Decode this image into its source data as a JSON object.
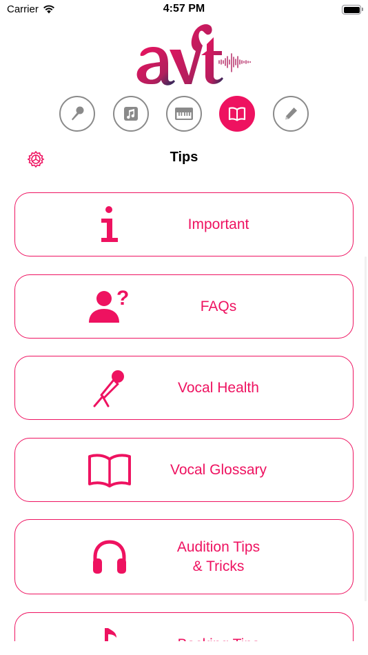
{
  "status_bar": {
    "carrier": "Carrier",
    "time": "4:57 PM"
  },
  "logo": {
    "text": "aVt",
    "colors": [
      "#ee1260",
      "#1e2a5a"
    ]
  },
  "tabs": [
    {
      "icon": "microphone-icon",
      "active": false
    },
    {
      "icon": "music-note-icon",
      "active": false
    },
    {
      "icon": "piano-keyboard-icon",
      "active": false
    },
    {
      "icon": "book-icon",
      "active": true
    },
    {
      "icon": "pencil-icon",
      "active": false
    }
  ],
  "header": {
    "title": "Tips",
    "settings_icon": "gear-icon"
  },
  "items": [
    {
      "icon": "info-icon",
      "label": "Important"
    },
    {
      "icon": "person-question-icon",
      "label": "FAQs"
    },
    {
      "icon": "microphone-stand-icon",
      "label": "Vocal Health"
    },
    {
      "icon": "open-book-icon",
      "label": "Vocal Glossary"
    },
    {
      "icon": "headphones-icon",
      "label_lines": [
        "Audition Tips",
        "& Tricks"
      ]
    },
    {
      "icon": "music-note-icon",
      "label": "Backing Tips"
    }
  ],
  "colors": {
    "accent": "#ee1260",
    "tab_inactive": "#8a8a8a",
    "navy": "#1e2a5a"
  }
}
